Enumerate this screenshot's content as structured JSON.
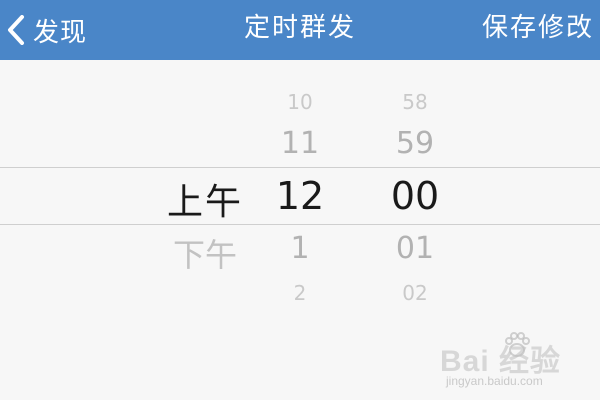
{
  "navbar": {
    "back_label": "发现",
    "title": "定时群发",
    "save_label": "保存修改",
    "bg_color": "#4a86c8",
    "text_color": "#ffffff"
  },
  "picker": {
    "ampm": {
      "selected": "上午",
      "below": "下午"
    },
    "hours": {
      "above_far": "10",
      "above_near": "11",
      "selected": "12",
      "below_near": "1",
      "below_far": "2"
    },
    "minutes": {
      "above_far": "58",
      "above_near": "59",
      "selected": "00",
      "below_near": "01",
      "below_far": "02"
    }
  },
  "watermark": {
    "main": "Bai 经验",
    "sub": "jingyan.baidu.com",
    "icon": "paw-icon"
  }
}
